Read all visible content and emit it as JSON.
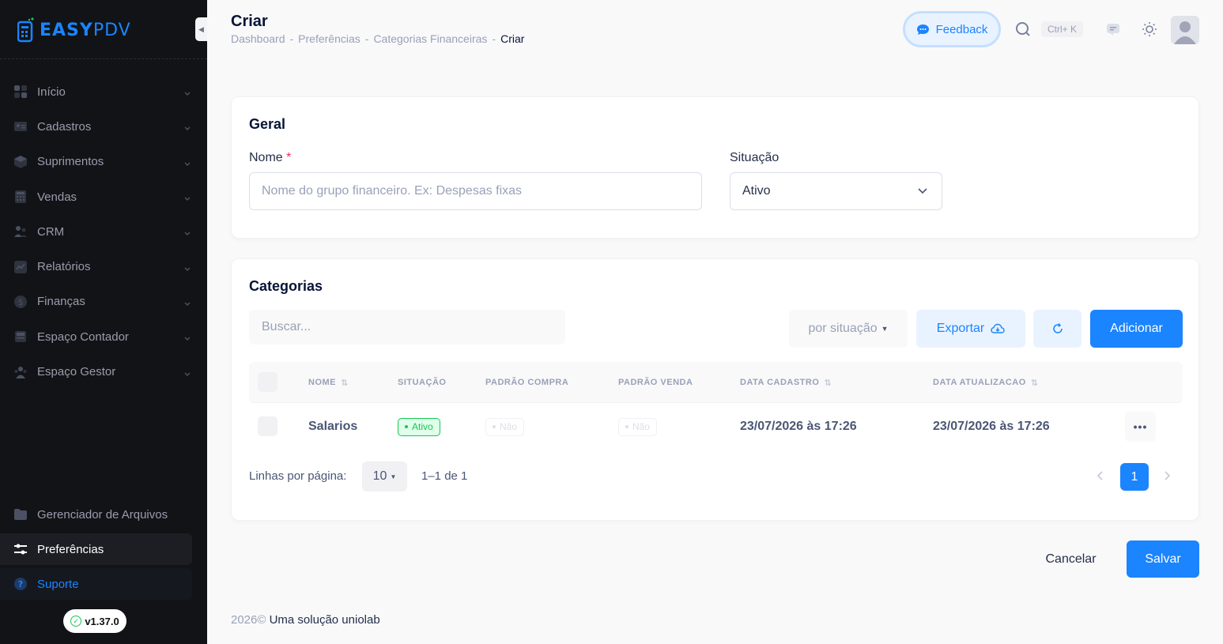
{
  "app": {
    "logo_main": "EASY",
    "logo_thin": "PDV",
    "version": "v1.37.0"
  },
  "colors": {
    "accent": "#1b84ff",
    "success": "#17c653",
    "sidebar": "#111316",
    "danger": "#f8285a"
  },
  "sidebar": {
    "items": [
      {
        "label": "Início",
        "icon": "home-icon"
      },
      {
        "label": "Cadastros",
        "icon": "id-card-icon"
      },
      {
        "label": "Suprimentos",
        "icon": "box-icon"
      },
      {
        "label": "Vendas",
        "icon": "calculator-icon"
      },
      {
        "label": "CRM",
        "icon": "people-icon"
      },
      {
        "label": "Relatórios",
        "icon": "chart-icon"
      },
      {
        "label": "Finanças",
        "icon": "dollar-icon"
      },
      {
        "label": "Espaço Contador",
        "icon": "register-icon"
      },
      {
        "label": "Espaço Gestor",
        "icon": "team-icon"
      }
    ],
    "bottom": [
      {
        "label": "Gerenciador de Arquivos",
        "icon": "folder-icon"
      },
      {
        "label": "Preferências",
        "icon": "sliders-icon"
      },
      {
        "label": "Suporte",
        "icon": "question-icon"
      }
    ]
  },
  "header": {
    "title": "Criar",
    "breadcrumb": [
      "Dashboard",
      "Preferências",
      "Categorias Financeiras",
      "Criar"
    ],
    "breadcrumb_sep": "-",
    "feedback_label": "Feedback",
    "search_shortcut": "Ctrl+ K"
  },
  "geral": {
    "title": "Geral",
    "nome_label": "Nome",
    "nome_required": "*",
    "nome_placeholder": "Nome do grupo financeiro. Ex: Despesas fixas",
    "situacao_label": "Situação",
    "situacao_value": "Ativo"
  },
  "categorias": {
    "title": "Categorias",
    "search_placeholder": "Buscar...",
    "filter_label": "por situação",
    "export_label": "Exportar",
    "add_label": "Adicionar",
    "columns": [
      "NOME",
      "SITUAÇÃO",
      "PADRÃO COMPRA",
      "PADRÃO VENDA",
      "DATA CADASTRO",
      "DATA ATUALIZACAO"
    ],
    "rows": [
      {
        "nome": "Salarios",
        "situacao": "Ativo",
        "padrao_compra": "Não",
        "padrao_venda": "Não",
        "data_cadastro": "23/07/2026 às 17:26",
        "data_atualizacao": "23/07/2026 às 17:26"
      }
    ],
    "pager": {
      "rows_label": "Linhas por página:",
      "page_size": "10",
      "range": "1–1 de 1",
      "current_page": "1"
    }
  },
  "actions": {
    "cancel": "Cancelar",
    "save": "Salvar"
  },
  "footer": {
    "year": "2026©",
    "text": "Uma solução uniolab"
  }
}
